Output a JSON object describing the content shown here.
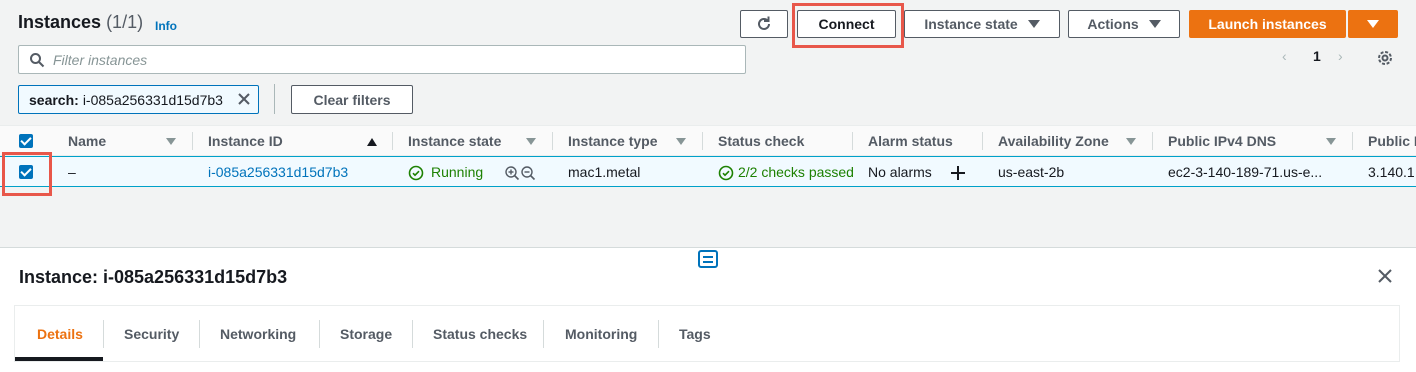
{
  "header": {
    "title": "Instances",
    "count": "(1/1)",
    "info_label": "Info"
  },
  "toolbar": {
    "refresh_icon": "refresh-icon",
    "connect_label": "Connect",
    "instance_state_label": "Instance state",
    "actions_label": "Actions",
    "launch_label": "Launch instances"
  },
  "search": {
    "placeholder": "Filter instances"
  },
  "pagination": {
    "page": "1",
    "prev": "‹",
    "next": "›"
  },
  "filter_token": {
    "key": "search:",
    "value": "i-085a256331d15d7b3"
  },
  "clear_filters_label": "Clear filters",
  "table": {
    "columns": [
      "Name",
      "Instance ID",
      "Instance state",
      "Instance type",
      "Status check",
      "Alarm status",
      "Availability Zone",
      "Public IPv4 DNS",
      "Public I"
    ],
    "row": {
      "name": "–",
      "instance_id": "i-085a256331d15d7b3",
      "instance_state": "Running",
      "instance_type": "mac1.metal",
      "status_check": "2/2 checks passed",
      "alarm_status": "No alarms",
      "availability_zone": "us-east-2b",
      "public_dns": "ec2-3-140-189-71.us-e...",
      "public_ip": "3.140.1"
    }
  },
  "details": {
    "title": "Instance: i-085a256331d15d7b3",
    "tabs": [
      "Details",
      "Security",
      "Networking",
      "Storage",
      "Status checks",
      "Monitoring",
      "Tags"
    ],
    "active_tab": "Details"
  },
  "colors": {
    "accent": "#ec7211",
    "link": "#0073bb",
    "success": "#1d8102",
    "highlight": "#e8574a"
  }
}
